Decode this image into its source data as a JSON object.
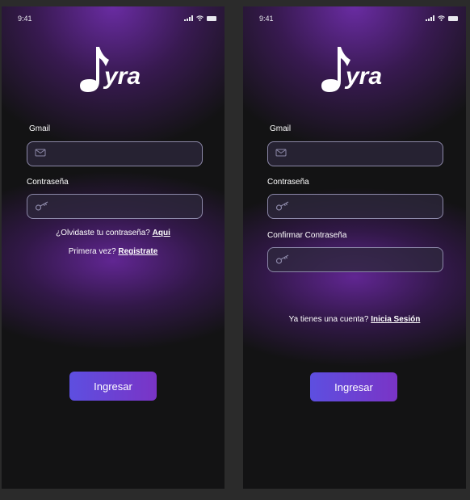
{
  "status_bar": {
    "time": "9:41"
  },
  "brand": {
    "logo_text": "yra"
  },
  "login": {
    "email_label": "Gmail",
    "password_label": "Contraseña",
    "forgot_text": "¿Olvidaste tu contraseña?",
    "forgot_link": "Aqui",
    "first_time_text": "Primera vez?",
    "register_link": "Registrate",
    "submit_label": "Ingresar"
  },
  "register": {
    "email_label": "Gmail",
    "password_label": "Contraseña",
    "confirm_label": "Confirmar Contraseña",
    "have_account_text": "Ya tienes una cuenta?",
    "login_link": "Inicia Sesión",
    "submit_label": "Ingresar"
  },
  "icons": [
    "mail-icon",
    "key-icon",
    "music-note-icon",
    "signal-icon",
    "wifi-icon",
    "battery-icon"
  ],
  "colors": {
    "background": "#131314",
    "accent_start": "#5d4fe0",
    "accent_end": "#7a34c6",
    "field_border": "#8c88a8"
  }
}
